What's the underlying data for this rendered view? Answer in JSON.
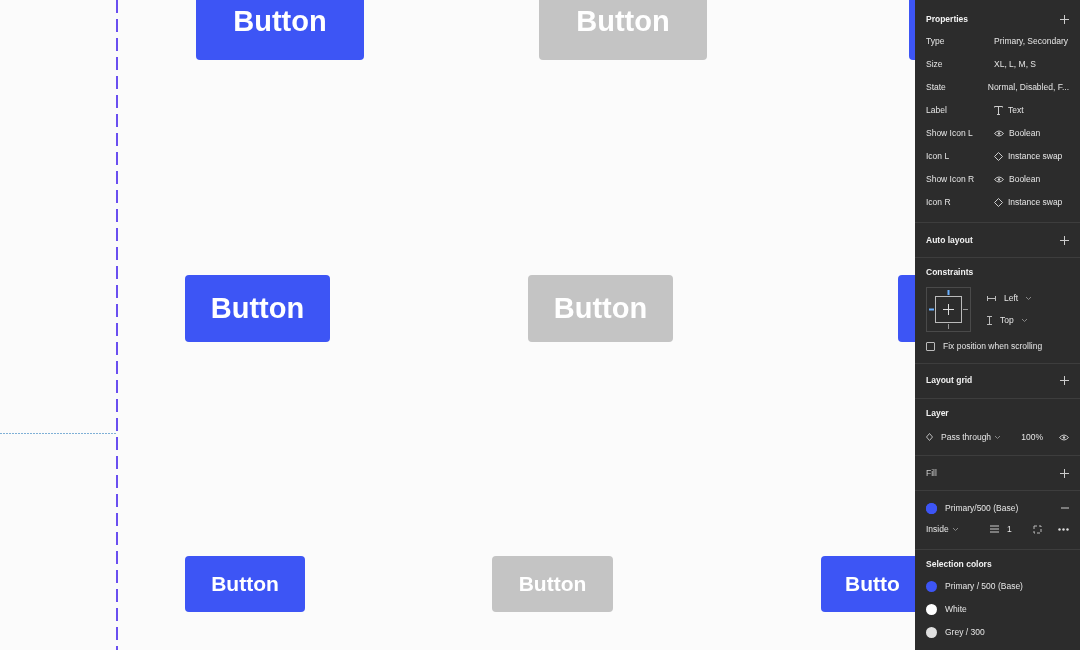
{
  "canvas": {
    "rows": [
      {
        "buttons": [
          {
            "kind": "primary",
            "label": "Button"
          },
          {
            "kind": "disabled",
            "label": "Button"
          },
          {
            "kind": "primary"
          }
        ]
      },
      {
        "buttons": [
          {
            "kind": "primary",
            "label": "Button"
          },
          {
            "kind": "disabled",
            "label": "Button"
          },
          {
            "kind": "primary"
          }
        ]
      },
      {
        "buttons": [
          {
            "kind": "primary",
            "label": "Button"
          },
          {
            "kind": "disabled",
            "label": "Button"
          },
          {
            "kind": "primary",
            "label": "Butto"
          }
        ]
      }
    ]
  },
  "panel": {
    "sections": [
      {
        "kind": "properties",
        "title": "Properties",
        "rows": [
          {
            "name": "Type",
            "value": "Primary, Secondary",
            "kind": "variant"
          },
          {
            "name": "Size",
            "value": "XL, L, M, S",
            "kind": "variant"
          },
          {
            "name": "State",
            "value": "Normal, Disabled, F...",
            "kind": "variant"
          },
          {
            "name": "Label",
            "value": "Text",
            "kind": "text"
          },
          {
            "name": "Show Icon L",
            "value": "Boolean",
            "kind": "boolean"
          },
          {
            "name": "Icon L",
            "value": "Instance swap",
            "kind": "instance"
          },
          {
            "name": "Show Icon R",
            "value": "Boolean",
            "kind": "boolean"
          },
          {
            "name": "Icon R",
            "value": "Instance swap",
            "kind": "instance"
          }
        ]
      },
      {
        "kind": "header",
        "title": "Auto layout"
      },
      {
        "kind": "constraints",
        "title": "Constraints",
        "horizontal": "Left",
        "vertical": "Top",
        "checkbox": {
          "label": "Fix position when scrolling",
          "checked": false
        }
      },
      {
        "kind": "header",
        "title": "Layout grid"
      },
      {
        "kind": "layer",
        "title": "Layer",
        "blend": "Pass through",
        "opacity": "100%"
      },
      {
        "kind": "header",
        "title": "Fill",
        "muted": true
      },
      {
        "kind": "stroke",
        "style": "Primary/500 (Base)",
        "color": "#3d55f5",
        "position": "Inside",
        "weight": "1"
      },
      {
        "kind": "colors",
        "title": "Selection colors",
        "colors": [
          {
            "name": "Primary / 500 (Base)",
            "color": "#3d55f5"
          },
          {
            "name": "White",
            "color": "#ffffff"
          },
          {
            "name": "Grey / 300",
            "color": "#e0e0e0"
          }
        ]
      }
    ]
  }
}
